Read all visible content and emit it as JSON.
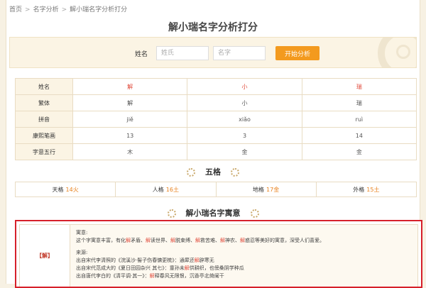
{
  "breadcrumb": [
    "首页",
    "名字分析",
    "解小瑞名字分析打分"
  ],
  "title": "解小瑞名字分析打分",
  "search": {
    "label": "姓名",
    "surname_placeholder": "姓氏",
    "given_placeholder": "名字",
    "button": "开始分析"
  },
  "name_table": {
    "rows": [
      {
        "label": "姓名",
        "values": [
          "解",
          "小",
          "瑞"
        ],
        "highlight": true
      },
      {
        "label": "繁体",
        "values": [
          "解",
          "小",
          "瑞"
        ]
      },
      {
        "label": "拼音",
        "values": [
          "jiě",
          "xiǎo",
          "ruì"
        ]
      },
      {
        "label": "康熙笔画",
        "values": [
          "13",
          "3",
          "14"
        ]
      },
      {
        "label": "字意五行",
        "values": [
          "木",
          "金",
          "金"
        ]
      }
    ]
  },
  "wuge": {
    "title": "五格",
    "cells": [
      {
        "label": "天格",
        "value": "14火"
      },
      {
        "label": "人格",
        "value": "16土"
      },
      {
        "label": "地格",
        "value": "17金"
      },
      {
        "label": "外格",
        "value": "15土"
      }
    ]
  },
  "meaning": {
    "title": "解小瑞名字寓意",
    "char": "【解】",
    "yiyi_label": "寓意:",
    "yiyi_segments": [
      "这个字寓意丰富，有化",
      "解",
      "矛盾、",
      "解",
      "读世界、",
      "解",
      "脱束缚、",
      "解",
      "救苦难、",
      "解",
      "神农、",
      "解",
      "惑忍等美好的寓意，深受人们喜爱。"
    ],
    "source_label": "来源:",
    "source_line1": [
      "出自宋代李清照的《浣溪沙·髻子伤春慵更梳》：通犀还",
      "解",
      "辟寒无"
    ],
    "source_line2": [
      "出自宋代范成大的《夏日田园杂兴 其七》：童孙未",
      "解",
      "供耕织，也傍桑阴学种瓜"
    ],
    "source_line3": [
      "出自唐代李白的《清平调·其一》：",
      "解",
      "释春风无限恨，沉香亭北倚阑干"
    ]
  },
  "colors": {
    "accent": "#f39a1e",
    "highlight": "#e04b3c",
    "border_red": "#d6202a",
    "panel_bg": "#fbf4e4"
  }
}
